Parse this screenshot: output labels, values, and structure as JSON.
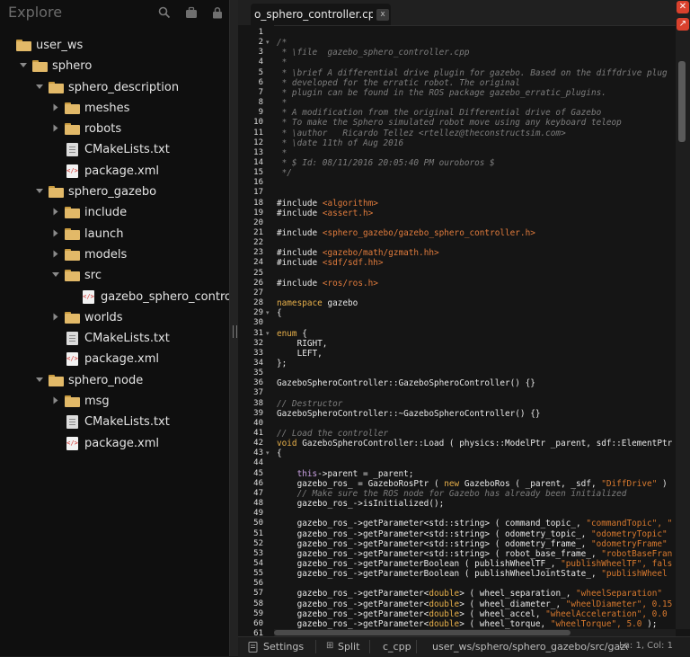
{
  "sidebar": {
    "title": "Explore",
    "tree": [
      {
        "label": "user_ws",
        "type": "folder",
        "depth": 0,
        "expanded": true
      },
      {
        "label": "sphero",
        "type": "folder",
        "depth": 1,
        "expanded": true
      },
      {
        "label": "sphero_description",
        "type": "folder",
        "depth": 2,
        "expanded": true
      },
      {
        "label": "meshes",
        "type": "folder",
        "depth": 3,
        "expanded": false
      },
      {
        "label": "robots",
        "type": "folder",
        "depth": 3,
        "expanded": false
      },
      {
        "label": "CMakeLists.txt",
        "type": "file",
        "depth": 3
      },
      {
        "label": "package.xml",
        "type": "xml",
        "depth": 3
      },
      {
        "label": "sphero_gazebo",
        "type": "folder",
        "depth": 2,
        "expanded": true
      },
      {
        "label": "include",
        "type": "folder",
        "depth": 3,
        "expanded": false
      },
      {
        "label": "launch",
        "type": "folder",
        "depth": 3,
        "expanded": false
      },
      {
        "label": "models",
        "type": "folder",
        "depth": 3,
        "expanded": false
      },
      {
        "label": "src",
        "type": "folder",
        "depth": 3,
        "expanded": true
      },
      {
        "label": "gazebo_sphero_controlle",
        "type": "xml",
        "depth": 4
      },
      {
        "label": "worlds",
        "type": "folder",
        "depth": 3,
        "expanded": false
      },
      {
        "label": "CMakeLists.txt",
        "type": "file",
        "depth": 3
      },
      {
        "label": "package.xml",
        "type": "xml",
        "depth": 3
      },
      {
        "label": "sphero_node",
        "type": "folder",
        "depth": 2,
        "expanded": true
      },
      {
        "label": "msg",
        "type": "folder",
        "depth": 3,
        "expanded": false
      },
      {
        "label": "CMakeLists.txt",
        "type": "file",
        "depth": 3
      },
      {
        "label": "package.xml",
        "type": "xml",
        "depth": 3
      }
    ]
  },
  "editor": {
    "tab_label": "o_sphero_controller.cpp",
    "tab_close": "x",
    "lines": [
      {
        "n": "1",
        "fold": "",
        "parts": [
          [
            "t",
            ""
          ]
        ]
      },
      {
        "n": "2",
        "fold": "▾",
        "parts": [
          [
            "cm",
            "/*"
          ]
        ]
      },
      {
        "n": "3",
        "fold": "",
        "parts": [
          [
            "cm",
            " * \\file  gazebo_sphero_controller.cpp"
          ]
        ]
      },
      {
        "n": "4",
        "fold": "",
        "parts": [
          [
            "cm",
            " *"
          ]
        ]
      },
      {
        "n": "5",
        "fold": "",
        "parts": [
          [
            "cm",
            " * \\brief A differential drive plugin for gazebo. Based on the diffdrive plug"
          ]
        ]
      },
      {
        "n": "6",
        "fold": "",
        "parts": [
          [
            "cm",
            " * developed for the erratic robot. The original"
          ]
        ]
      },
      {
        "n": "7",
        "fold": "",
        "parts": [
          [
            "cm",
            " * plugin can be found in the ROS package gazebo_erratic_plugins."
          ]
        ]
      },
      {
        "n": "8",
        "fold": "",
        "parts": [
          [
            "cm",
            " *"
          ]
        ]
      },
      {
        "n": "9",
        "fold": "",
        "parts": [
          [
            "cm",
            " * A modification from the original Differential drive of Gazebo"
          ]
        ]
      },
      {
        "n": "10",
        "fold": "",
        "parts": [
          [
            "cm",
            " * To make the Sphero simulated robot move using any keyboard teleop"
          ]
        ]
      },
      {
        "n": "11",
        "fold": "",
        "parts": [
          [
            "cm",
            " * \\author   Ricardo Tellez <rtellez@theconstructsim.com>"
          ]
        ]
      },
      {
        "n": "12",
        "fold": "",
        "parts": [
          [
            "cm",
            " * \\date 11th of Aug 2016"
          ]
        ]
      },
      {
        "n": "13",
        "fold": "",
        "parts": [
          [
            "cm",
            " *"
          ]
        ]
      },
      {
        "n": "14",
        "fold": "",
        "parts": [
          [
            "cm",
            " * $ Id: 08/11/2016 20:05:40 PM ouroboros $"
          ]
        ]
      },
      {
        "n": "15",
        "fold": "",
        "parts": [
          [
            "cm",
            " */"
          ]
        ]
      },
      {
        "n": "16",
        "fold": "",
        "parts": [
          [
            "t",
            ""
          ]
        ]
      },
      {
        "n": "17",
        "fold": "",
        "parts": [
          [
            "t",
            ""
          ]
        ]
      },
      {
        "n": "18",
        "fold": "",
        "parts": [
          [
            "t",
            "#include "
          ],
          [
            "inc",
            "<algorithm>"
          ]
        ]
      },
      {
        "n": "19",
        "fold": "",
        "parts": [
          [
            "t",
            "#include "
          ],
          [
            "inc",
            "<assert.h>"
          ]
        ]
      },
      {
        "n": "20",
        "fold": "",
        "parts": [
          [
            "t",
            ""
          ]
        ]
      },
      {
        "n": "21",
        "fold": "",
        "parts": [
          [
            "t",
            "#include "
          ],
          [
            "inc",
            "<sphero_gazebo/gazebo_sphero_controller.h>"
          ]
        ]
      },
      {
        "n": "22",
        "fold": "",
        "parts": [
          [
            "t",
            ""
          ]
        ]
      },
      {
        "n": "23",
        "fold": "",
        "parts": [
          [
            "t",
            "#include "
          ],
          [
            "inc",
            "<gazebo/math/gzmath.hh>"
          ]
        ]
      },
      {
        "n": "24",
        "fold": "",
        "parts": [
          [
            "t",
            "#include "
          ],
          [
            "inc",
            "<sdf/sdf.hh>"
          ]
        ]
      },
      {
        "n": "25",
        "fold": "",
        "parts": [
          [
            "t",
            ""
          ]
        ]
      },
      {
        "n": "26",
        "fold": "",
        "parts": [
          [
            "t",
            "#include "
          ],
          [
            "inc",
            "<ros/ros.h>"
          ]
        ]
      },
      {
        "n": "27",
        "fold": "",
        "parts": [
          [
            "t",
            ""
          ]
        ]
      },
      {
        "n": "28",
        "fold": "",
        "parts": [
          [
            "kw",
            "namespace"
          ],
          [
            "t",
            " gazebo"
          ]
        ]
      },
      {
        "n": "29",
        "fold": "▾",
        "parts": [
          [
            "t",
            "{"
          ]
        ]
      },
      {
        "n": "30",
        "fold": "",
        "parts": [
          [
            "t",
            ""
          ]
        ]
      },
      {
        "n": "31",
        "fold": "▾",
        "parts": [
          [
            "kw",
            "enum"
          ],
          [
            "t",
            " {"
          ]
        ]
      },
      {
        "n": "32",
        "fold": "",
        "parts": [
          [
            "t",
            "    RIGHT,"
          ]
        ]
      },
      {
        "n": "33",
        "fold": "",
        "parts": [
          [
            "t",
            "    LEFT,"
          ]
        ]
      },
      {
        "n": "34",
        "fold": "",
        "parts": [
          [
            "t",
            "};"
          ]
        ]
      },
      {
        "n": "35",
        "fold": "",
        "parts": [
          [
            "t",
            ""
          ]
        ]
      },
      {
        "n": "36",
        "fold": "",
        "parts": [
          [
            "t",
            "GazeboSpheroController::GazeboSpheroController() {}"
          ]
        ]
      },
      {
        "n": "37",
        "fold": "",
        "parts": [
          [
            "t",
            ""
          ]
        ]
      },
      {
        "n": "38",
        "fold": "",
        "parts": [
          [
            "cm",
            "// Destructor"
          ]
        ]
      },
      {
        "n": "39",
        "fold": "",
        "parts": [
          [
            "t",
            "GazeboSpheroController::~GazeboSpheroController() {}"
          ]
        ]
      },
      {
        "n": "40",
        "fold": "",
        "parts": [
          [
            "t",
            ""
          ]
        ]
      },
      {
        "n": "41",
        "fold": "",
        "parts": [
          [
            "cm",
            "// Load the controller"
          ]
        ]
      },
      {
        "n": "42",
        "fold": "",
        "parts": [
          [
            "kw",
            "void"
          ],
          [
            "t",
            " GazeboSpheroController::Load ( physics::ModelPtr _parent, sdf::ElementPtr"
          ]
        ]
      },
      {
        "n": "43",
        "fold": "▾",
        "parts": [
          [
            "t",
            "{"
          ]
        ]
      },
      {
        "n": "44",
        "fold": "",
        "parts": [
          [
            "t",
            ""
          ]
        ]
      },
      {
        "n": "45",
        "fold": "",
        "parts": [
          [
            "t",
            "    "
          ],
          [
            "ptr",
            "this"
          ],
          [
            "t",
            "->parent = _parent;"
          ]
        ]
      },
      {
        "n": "46",
        "fold": "",
        "parts": [
          [
            "t",
            "    gazebo_ros_ = GazeboRosPtr ( "
          ],
          [
            "kw",
            "new"
          ],
          [
            "t",
            " GazeboRos ( _parent, _sdf, "
          ],
          [
            "str",
            "\"DiffDrive\""
          ],
          [
            "t",
            " )"
          ]
        ]
      },
      {
        "n": "47",
        "fold": "",
        "parts": [
          [
            "cm",
            "    // Make sure the ROS node for Gazebo has already been initialized"
          ]
        ]
      },
      {
        "n": "48",
        "fold": "",
        "parts": [
          [
            "t",
            "    gazebo_ros_->isInitialized();"
          ]
        ]
      },
      {
        "n": "49",
        "fold": "",
        "parts": [
          [
            "t",
            ""
          ]
        ]
      },
      {
        "n": "50",
        "fold": "",
        "parts": [
          [
            "t",
            "    gazebo_ros_->getParameter<std::string> ( command_topic_, "
          ],
          [
            "str",
            "\"commandTopic\", \""
          ]
        ]
      },
      {
        "n": "51",
        "fold": "",
        "parts": [
          [
            "t",
            "    gazebo_ros_->getParameter<std::string> ( odometry_topic_, "
          ],
          [
            "str",
            "\"odometryTopic\""
          ]
        ]
      },
      {
        "n": "52",
        "fold": "",
        "parts": [
          [
            "t",
            "    gazebo_ros_->getParameter<std::string> ( odometry_frame_, "
          ],
          [
            "str",
            "\"odometryFrame\""
          ]
        ]
      },
      {
        "n": "53",
        "fold": "",
        "parts": [
          [
            "t",
            "    gazebo_ros_->getParameter<std::string> ( robot_base_frame_, "
          ],
          [
            "str",
            "\"robotBaseFran"
          ]
        ]
      },
      {
        "n": "54",
        "fold": "",
        "parts": [
          [
            "t",
            "    gazebo_ros_->getParameterBoolean ( publishWheelTF_, "
          ],
          [
            "str",
            "\"publishWheelTF\", fals"
          ]
        ]
      },
      {
        "n": "55",
        "fold": "",
        "parts": [
          [
            "t",
            "    gazebo_ros_->getParameterBoolean ( publishWheelJointState_, "
          ],
          [
            "str",
            "\"publishWheel"
          ]
        ]
      },
      {
        "n": "56",
        "fold": "",
        "parts": [
          [
            "t",
            ""
          ]
        ]
      },
      {
        "n": "57",
        "fold": "",
        "parts": [
          [
            "t",
            "    gazebo_ros_->getParameter<"
          ],
          [
            "kw",
            "double"
          ],
          [
            "t",
            "> ( wheel_separation_, "
          ],
          [
            "str",
            "\"wheelSeparation\""
          ]
        ]
      },
      {
        "n": "58",
        "fold": "",
        "parts": [
          [
            "t",
            "    gazebo_ros_->getParameter<"
          ],
          [
            "kw",
            "double"
          ],
          [
            "t",
            "> ( wheel_diameter_, "
          ],
          [
            "str",
            "\"wheelDiameter\", 0.15"
          ]
        ]
      },
      {
        "n": "59",
        "fold": "",
        "parts": [
          [
            "t",
            "    gazebo_ros_->getParameter<"
          ],
          [
            "kw",
            "double"
          ],
          [
            "t",
            "> ( wheel_accel, "
          ],
          [
            "str",
            "\"wheelAcceleration\", 0.0"
          ]
        ]
      },
      {
        "n": "60",
        "fold": "",
        "parts": [
          [
            "t",
            "    gazebo_ros_->getParameter<"
          ],
          [
            "kw",
            "double"
          ],
          [
            "t",
            "> ( wheel_torque, "
          ],
          [
            "str",
            "\"wheelTorque\", 5.0"
          ],
          [
            "t",
            " );"
          ]
        ]
      },
      {
        "n": "61",
        "fold": "",
        "parts": [
          [
            "t",
            ""
          ]
        ]
      }
    ]
  },
  "status": {
    "settings": "Settings",
    "split": "Split",
    "mode": "c_cpp",
    "path": "user_ws/sphero/sphero_gazebo/src/gazebo_sphero_contro",
    "position": "Ln: 1, Col: 1"
  }
}
